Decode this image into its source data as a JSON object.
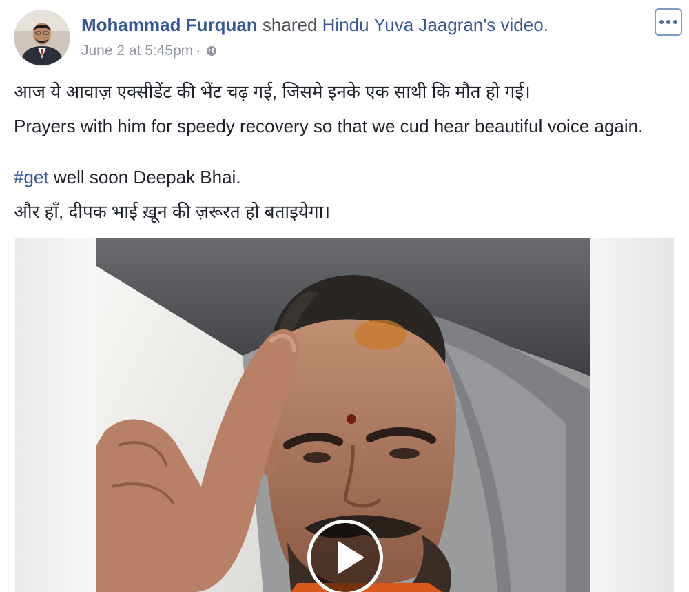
{
  "post": {
    "author": {
      "name": "Mohammad Furquan",
      "action": "shared",
      "shared_page": "Hindu Yuva Jaagran's video."
    },
    "meta": {
      "timestamp": "June 2 at 5:45pm",
      "separator": "·",
      "audience_icon": "globe-icon"
    },
    "more_options_icon": "more-options-icon",
    "text": {
      "line1": "आज ये आवाज़ एक्सीडेंट की भेंट चढ़ गई, जिसमे इनके एक साथी कि मौत हो गई।",
      "line2": "Prayers with him for speedy recovery so that we cud hear beautiful voice again.",
      "hashtag": "#get",
      "line3_rest": " well soon Deepak Bhai.",
      "line4": "और हाँ, दीपक भाई ख़ून की ज़रूरत हो बताइयेगा।"
    },
    "video": {
      "play_icon": "play-icon"
    }
  },
  "colors": {
    "link": "#365899",
    "text": "#1d2129",
    "meta": "#90949c"
  }
}
